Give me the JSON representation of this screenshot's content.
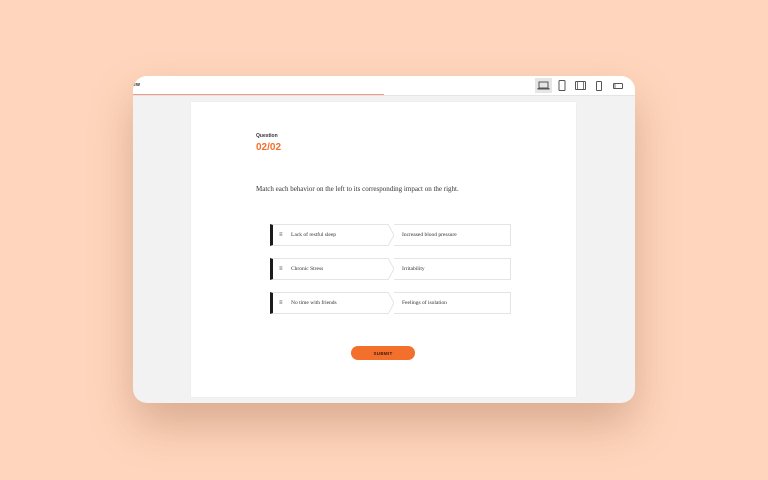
{
  "topbar": {
    "label": "ew",
    "devices": [
      {
        "name": "laptop",
        "active": true
      },
      {
        "name": "tablet-portrait",
        "active": false
      },
      {
        "name": "tablet-landscape",
        "active": false
      },
      {
        "name": "phone-portrait",
        "active": false
      },
      {
        "name": "phone-landscape",
        "active": false
      }
    ]
  },
  "question": {
    "label": "Question",
    "number": "02/02",
    "prompt": "Match each behavior on the left to its corresponding impact on the right."
  },
  "pairs": [
    {
      "left": "Lack of restful sleep",
      "right": "Increased blood pressure"
    },
    {
      "left": "Chronic Stress",
      "right": "Irritability"
    },
    {
      "left": "No time with friends",
      "right": "Feelings of isolation"
    }
  ],
  "grip_glyph": "≡",
  "submit_label": "SUBMIT",
  "colors": {
    "accent": "#f36f2c",
    "background": "#ffd6bd",
    "progress": "#f19a86"
  }
}
